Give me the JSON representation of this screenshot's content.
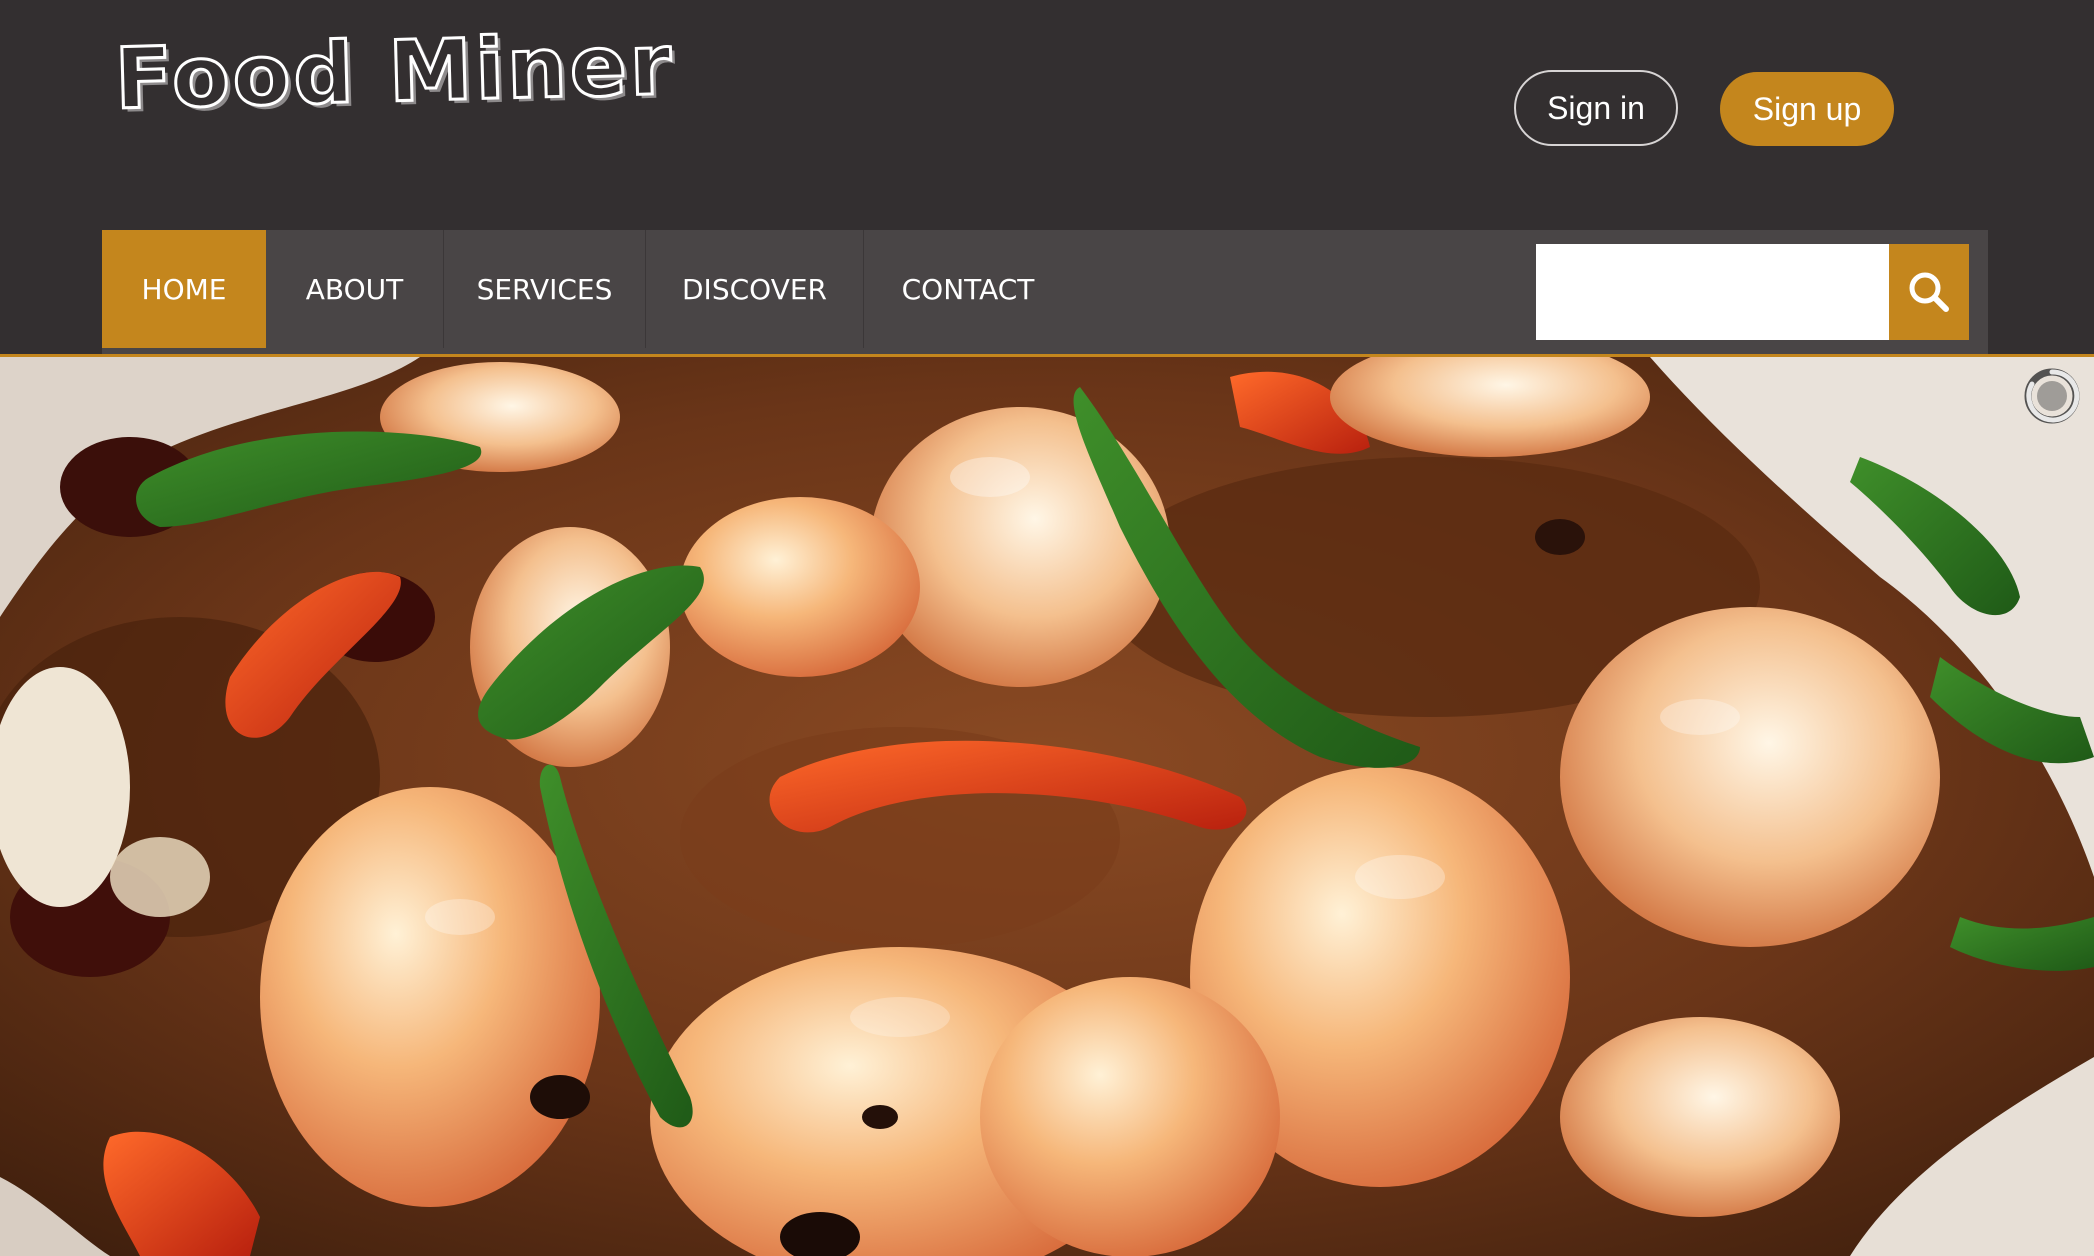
{
  "header": {
    "logo_text": "Food Miner",
    "signin_label": "Sign in",
    "signup_label": "Sign up"
  },
  "nav": {
    "items": [
      {
        "label": "HOME",
        "active": true
      },
      {
        "label": "ABOUT",
        "active": false
      },
      {
        "label": "SERVICES",
        "active": false
      },
      {
        "label": "DISCOVER",
        "active": false
      },
      {
        "label": "CONTACT",
        "active": false
      }
    ]
  },
  "search": {
    "value": "",
    "placeholder": ""
  },
  "hero": {
    "image_subject": "shrimp stir-fry with peppers and green onions",
    "loader_icon": "loading-spinner-icon"
  },
  "colors": {
    "background": "#332f30",
    "navbar": "#494546",
    "accent": "#c4861d",
    "text": "#ffffff"
  }
}
